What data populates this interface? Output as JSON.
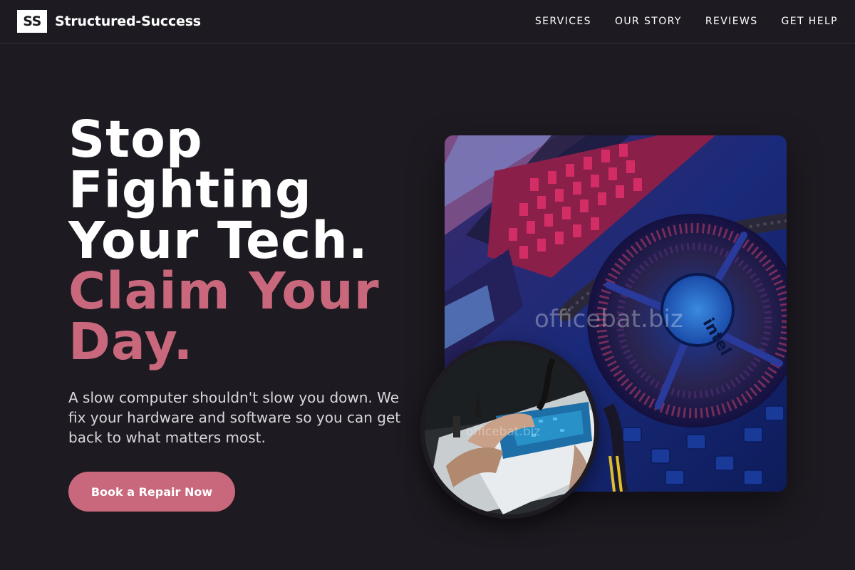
{
  "brand": {
    "logo": "SS",
    "name": "Structured-Success"
  },
  "nav": {
    "links": [
      "SERVICES",
      "OUR STORY",
      "REVIEWS",
      "GET HELP"
    ]
  },
  "hero": {
    "headline_lines": [
      "Stop",
      "Fighting",
      "Your Tech."
    ],
    "headline_accent_lines": [
      "Claim Your",
      "Day."
    ],
    "subtitle": "A slow computer shouldn't slow you down. We fix your hardware and software so you can get back to what matters most.",
    "cta_label": "Book a Repair Now"
  },
  "images": {
    "main": {
      "watermark": "officebat.biz",
      "cooler_brand": "intel"
    },
    "inset": {
      "watermark": "officebat.biz"
    }
  },
  "colors": {
    "background": "#1d1a21",
    "accent": "#c9687c",
    "text": "#ffffff"
  }
}
